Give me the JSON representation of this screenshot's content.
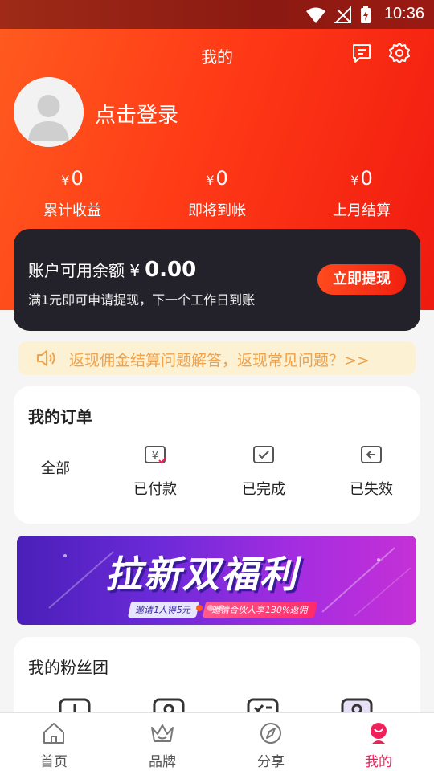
{
  "status_bar": {
    "time": "10:36"
  },
  "header": {
    "title": "我的",
    "login_text": "点击登录"
  },
  "stats": [
    {
      "currency": "¥",
      "value": "0",
      "label": "累计收益"
    },
    {
      "currency": "¥",
      "value": "0",
      "label": "即将到帐"
    },
    {
      "currency": "¥",
      "value": "0",
      "label": "上月结算"
    }
  ],
  "balance": {
    "title": "账户可用余额",
    "currency": "¥",
    "amount": "0.00",
    "subtitle": "满1元即可申请提现，下一个工作日到账",
    "button_label": "立即提现"
  },
  "notice": {
    "text": "返现佣金结算问题解答，返现常见问题？>>"
  },
  "orders": {
    "title": "我的订单",
    "all_label": "全部",
    "items": [
      {
        "label": "已付款",
        "icon": "paid-icon"
      },
      {
        "label": "已完成",
        "icon": "completed-icon"
      },
      {
        "label": "已失效",
        "icon": "expired-icon"
      }
    ]
  },
  "banner": {
    "headline": "拉新双福利",
    "pill_1": "邀请1人得5元",
    "pill_2": "邀请合伙人享130%返佣"
  },
  "fans": {
    "title": "我的粉丝团"
  },
  "tabbar": {
    "items": [
      {
        "label": "首页",
        "icon": "home-icon"
      },
      {
        "label": "品牌",
        "icon": "crown-icon"
      },
      {
        "label": "分享",
        "icon": "compass-icon"
      },
      {
        "label": "我的",
        "icon": "profile-icon"
      }
    ],
    "active_index": 3,
    "active_color": "#f0205a"
  },
  "colors": {
    "header_red": "#f0200f",
    "card_dark": "#23222a",
    "notice_bg": "#fdf1d4",
    "notice_text": "#f0a24a"
  }
}
